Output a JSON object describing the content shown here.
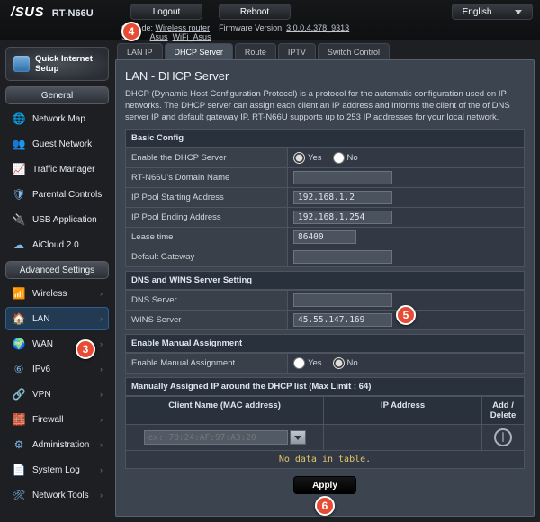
{
  "top": {
    "brand": "/SUS",
    "model": "RT-N66U",
    "logout": "Logout",
    "reboot": "Reboot",
    "language": "English",
    "op_label": "Oper          de:",
    "op_mode": "Wireless router",
    "fw_label": "Firmware Version:",
    "fw_ver": "3.0.0.4.378_9313",
    "ssid_label": "SSI",
    "ssid1": "Asus",
    "ssid2": "WiFi_Asus"
  },
  "qis": {
    "label": "Quick Internet\nSetup"
  },
  "sections": {
    "general": "General",
    "advanced": "Advanced Settings"
  },
  "nav_general": [
    {
      "icon": "🌐",
      "label": "Network Map"
    },
    {
      "icon": "👥",
      "label": "Guest Network"
    },
    {
      "icon": "📈",
      "label": "Traffic Manager"
    },
    {
      "icon": "🛡",
      "label": "Parental Controls"
    },
    {
      "icon": "🔌",
      "label": "USB Application"
    },
    {
      "icon": "☁",
      "label": "AiCloud 2.0"
    }
  ],
  "nav_advanced": [
    {
      "icon": "📶",
      "label": "Wireless"
    },
    {
      "icon": "🏠",
      "label": "LAN",
      "active": true
    },
    {
      "icon": "🌍",
      "label": "WAN"
    },
    {
      "icon": "⑥",
      "label": "IPv6"
    },
    {
      "icon": "🔗",
      "label": "VPN"
    },
    {
      "icon": "🧱",
      "label": "Firewall"
    },
    {
      "icon": "⚙",
      "label": "Administration"
    },
    {
      "icon": "📄",
      "label": "System Log"
    },
    {
      "icon": "🛠",
      "label": "Network Tools"
    }
  ],
  "tabs": [
    "LAN IP",
    "DHCP Server",
    "Route",
    "IPTV",
    "Switch Control"
  ],
  "active_tab": "DHCP Server",
  "panel": {
    "title": "LAN - DHCP Server",
    "desc": "DHCP (Dynamic Host Configuration Protocol) is a protocol for the automatic configuration used on IP networks. The DHCP server can assign each client an IP address and informs the client of the of DNS server IP and default gateway IP. RT-N66U supports up to 253 IP addresses for your local network.",
    "basic_h": "Basic Config",
    "rows": {
      "enable_label": "Enable the DHCP Server",
      "enable_yes": "Yes",
      "enable_no": "No",
      "domain_label": "RT-N66U's Domain Name",
      "domain_val": "",
      "start_label": "IP Pool Starting Address",
      "start_val": "192.168.1.2",
      "end_label": "IP Pool Ending Address",
      "end_val": "192.168.1.254",
      "lease_label": "Lease time",
      "lease_val": "86400",
      "gw_label": "Default Gateway",
      "gw_val": ""
    },
    "dns_h": "DNS and WINS Server Setting",
    "dns_label": "DNS Server",
    "dns_val": "",
    "wins_label": "WINS Server",
    "wins_val": "45.55.147.169",
    "manual_h": "Enable Manual Assignment",
    "manual_label": "Enable Manual Assignment",
    "manual_yes": "Yes",
    "manual_no": "No",
    "list_h": "Manually Assigned IP around the DHCP list (Max Limit : 64)",
    "col_mac": "Client Name (MAC address)",
    "col_ip": "IP Address",
    "col_act": "Add / Delete",
    "mac_placeholder": "ex: 78:24:AF:97:A3:20",
    "nodata": "No data in table.",
    "apply": "Apply"
  },
  "markers": {
    "m3": "3",
    "m4": "4",
    "m5": "5",
    "m6": "6"
  }
}
